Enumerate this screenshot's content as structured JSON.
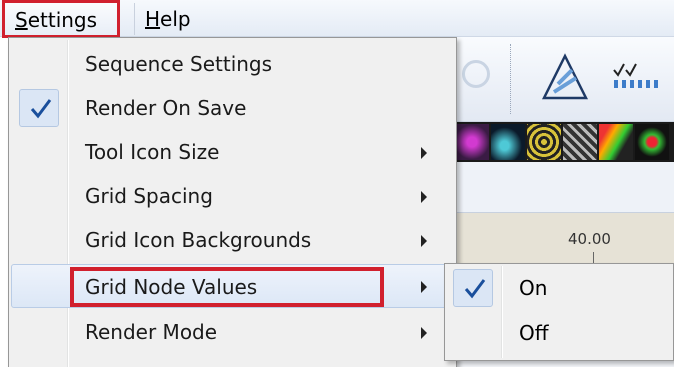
{
  "menubar": {
    "settings": {
      "prefix_underlined": "S",
      "rest": "ettings"
    },
    "help": {
      "prefix_underlined": "H",
      "rest": "elp"
    }
  },
  "ruler": {
    "label": "40.00"
  },
  "settings_menu": {
    "items": [
      {
        "label": "Sequence Settings",
        "checked": false,
        "has_submenu": false
      },
      {
        "label": "Render On Save",
        "checked": true,
        "has_submenu": false
      },
      {
        "label": "Tool Icon Size",
        "checked": false,
        "has_submenu": true
      },
      {
        "label": "Grid Spacing",
        "checked": false,
        "has_submenu": true
      },
      {
        "label": "Grid Icon Backgrounds",
        "checked": false,
        "has_submenu": true
      },
      {
        "label": "Grid Node Values",
        "checked": false,
        "has_submenu": true,
        "hovered": true
      },
      {
        "label": "Render Mode",
        "checked": false,
        "has_submenu": true
      }
    ]
  },
  "grid_node_values_submenu": {
    "items": [
      {
        "label": "On",
        "checked": true
      },
      {
        "label": "Off",
        "checked": false
      }
    ]
  },
  "colors": {
    "highlight_red": "#d1202e",
    "check_blue": "#1a4f9c",
    "hover_bg": "#dce7f6",
    "menu_bg": "#f0f0f0"
  }
}
